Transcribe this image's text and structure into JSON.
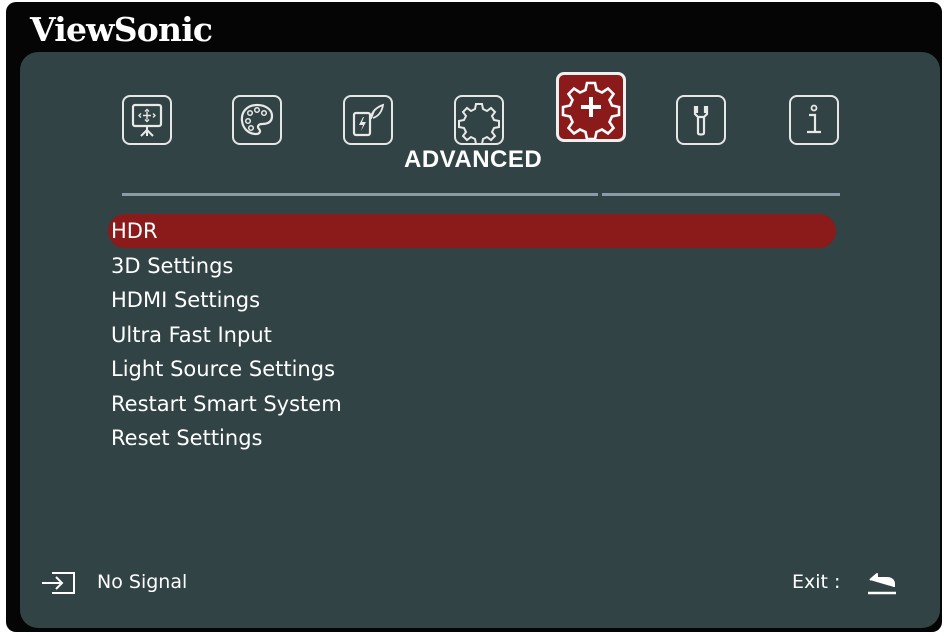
{
  "brand": {
    "name": "ViewSonic"
  },
  "tabs": [
    {
      "icon": "display-icon",
      "active": false
    },
    {
      "icon": "palette-icon",
      "active": false
    },
    {
      "icon": "power-eco-icon",
      "active": false
    },
    {
      "icon": "gear-icon",
      "active": false
    },
    {
      "icon": "advanced-gear-plus-icon",
      "active": true
    },
    {
      "icon": "wrench-icon",
      "active": false
    },
    {
      "icon": "info-icon",
      "active": false
    }
  ],
  "section": {
    "title": "ADVANCED"
  },
  "menu": {
    "items": [
      {
        "label": "HDR",
        "selected": true
      },
      {
        "label": "3D Settings",
        "selected": false
      },
      {
        "label": "HDMI Settings",
        "selected": false
      },
      {
        "label": "Ultra Fast Input",
        "selected": false
      },
      {
        "label": "Light Source Settings",
        "selected": false
      },
      {
        "label": "Restart Smart System",
        "selected": false
      },
      {
        "label": "Reset Settings",
        "selected": false
      }
    ]
  },
  "status": {
    "input_icon": "input-source-icon",
    "signal_text": "No Signal",
    "exit_label": "Exit :",
    "exit_icon": "return-arrow-icon"
  },
  "colors": {
    "panel": "#314344",
    "frame": "#050505",
    "highlight": "#8b1a1a",
    "divider": "#8a9aa6",
    "text": "#ffffff"
  }
}
